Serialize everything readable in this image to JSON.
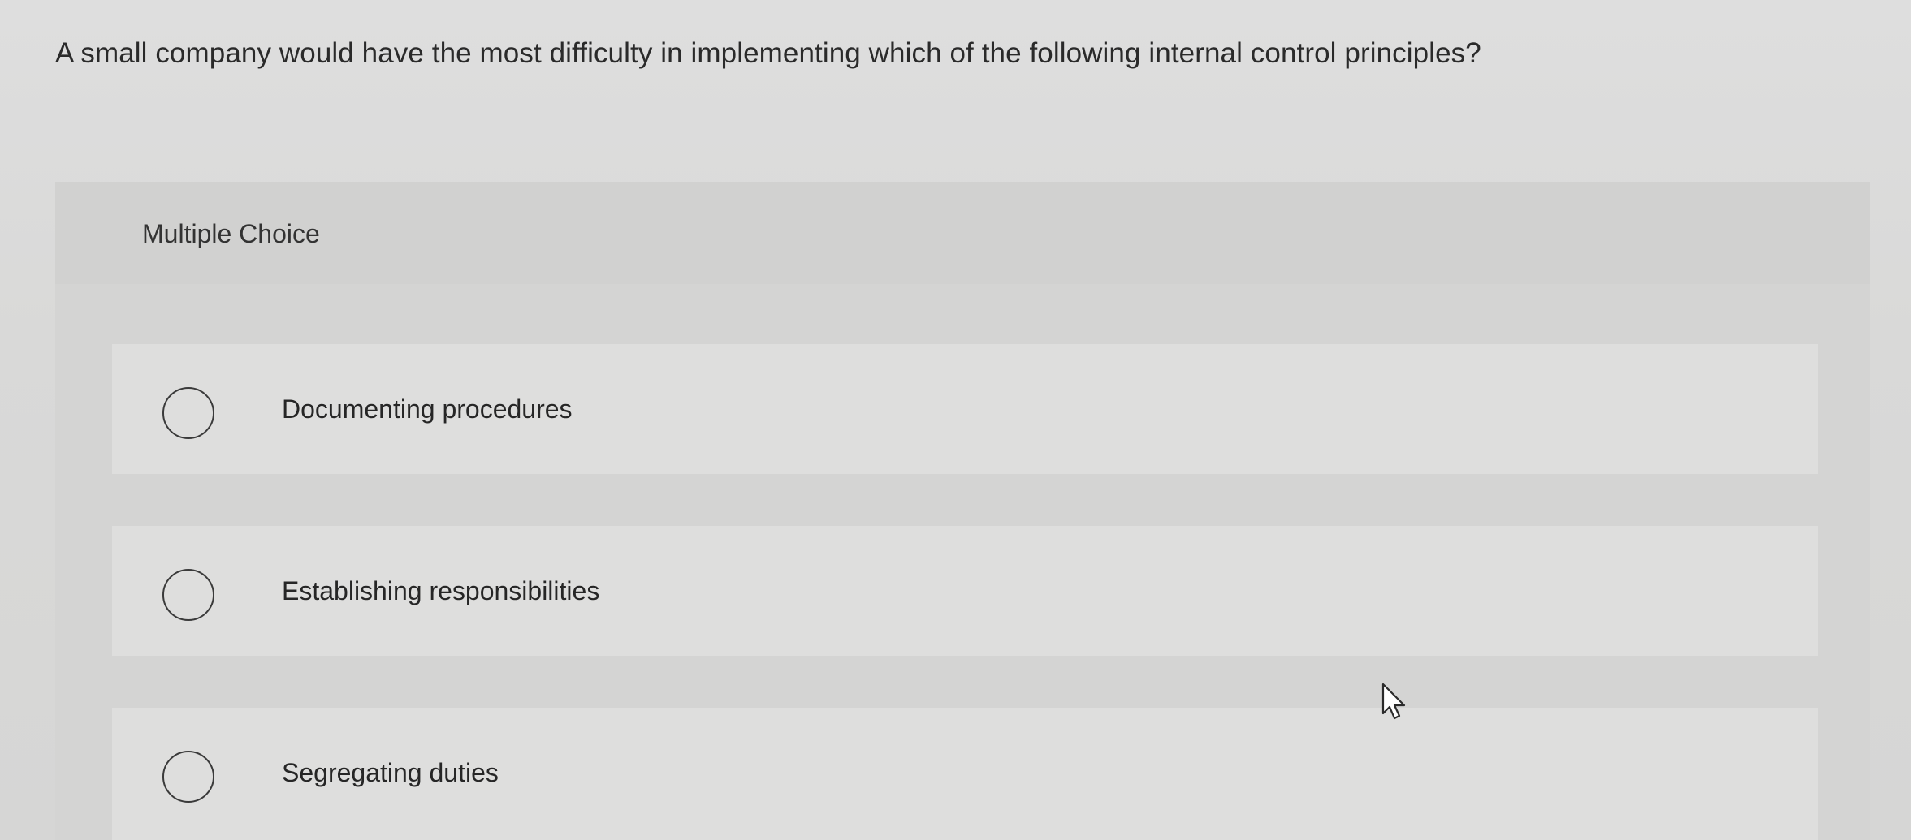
{
  "question": {
    "text": "A small company would have the most difficulty in implementing which of the following internal control principles?"
  },
  "multiple_choice": {
    "label": "Multiple Choice",
    "options": [
      {
        "label": "Documenting procedures",
        "selected": false
      },
      {
        "label": "Establishing responsibilities",
        "selected": false
      },
      {
        "label": "Segregating duties",
        "selected": false
      }
    ]
  },
  "icons": {
    "radio": "radio-empty-icon",
    "cursor": "hand-pointer-icon"
  }
}
